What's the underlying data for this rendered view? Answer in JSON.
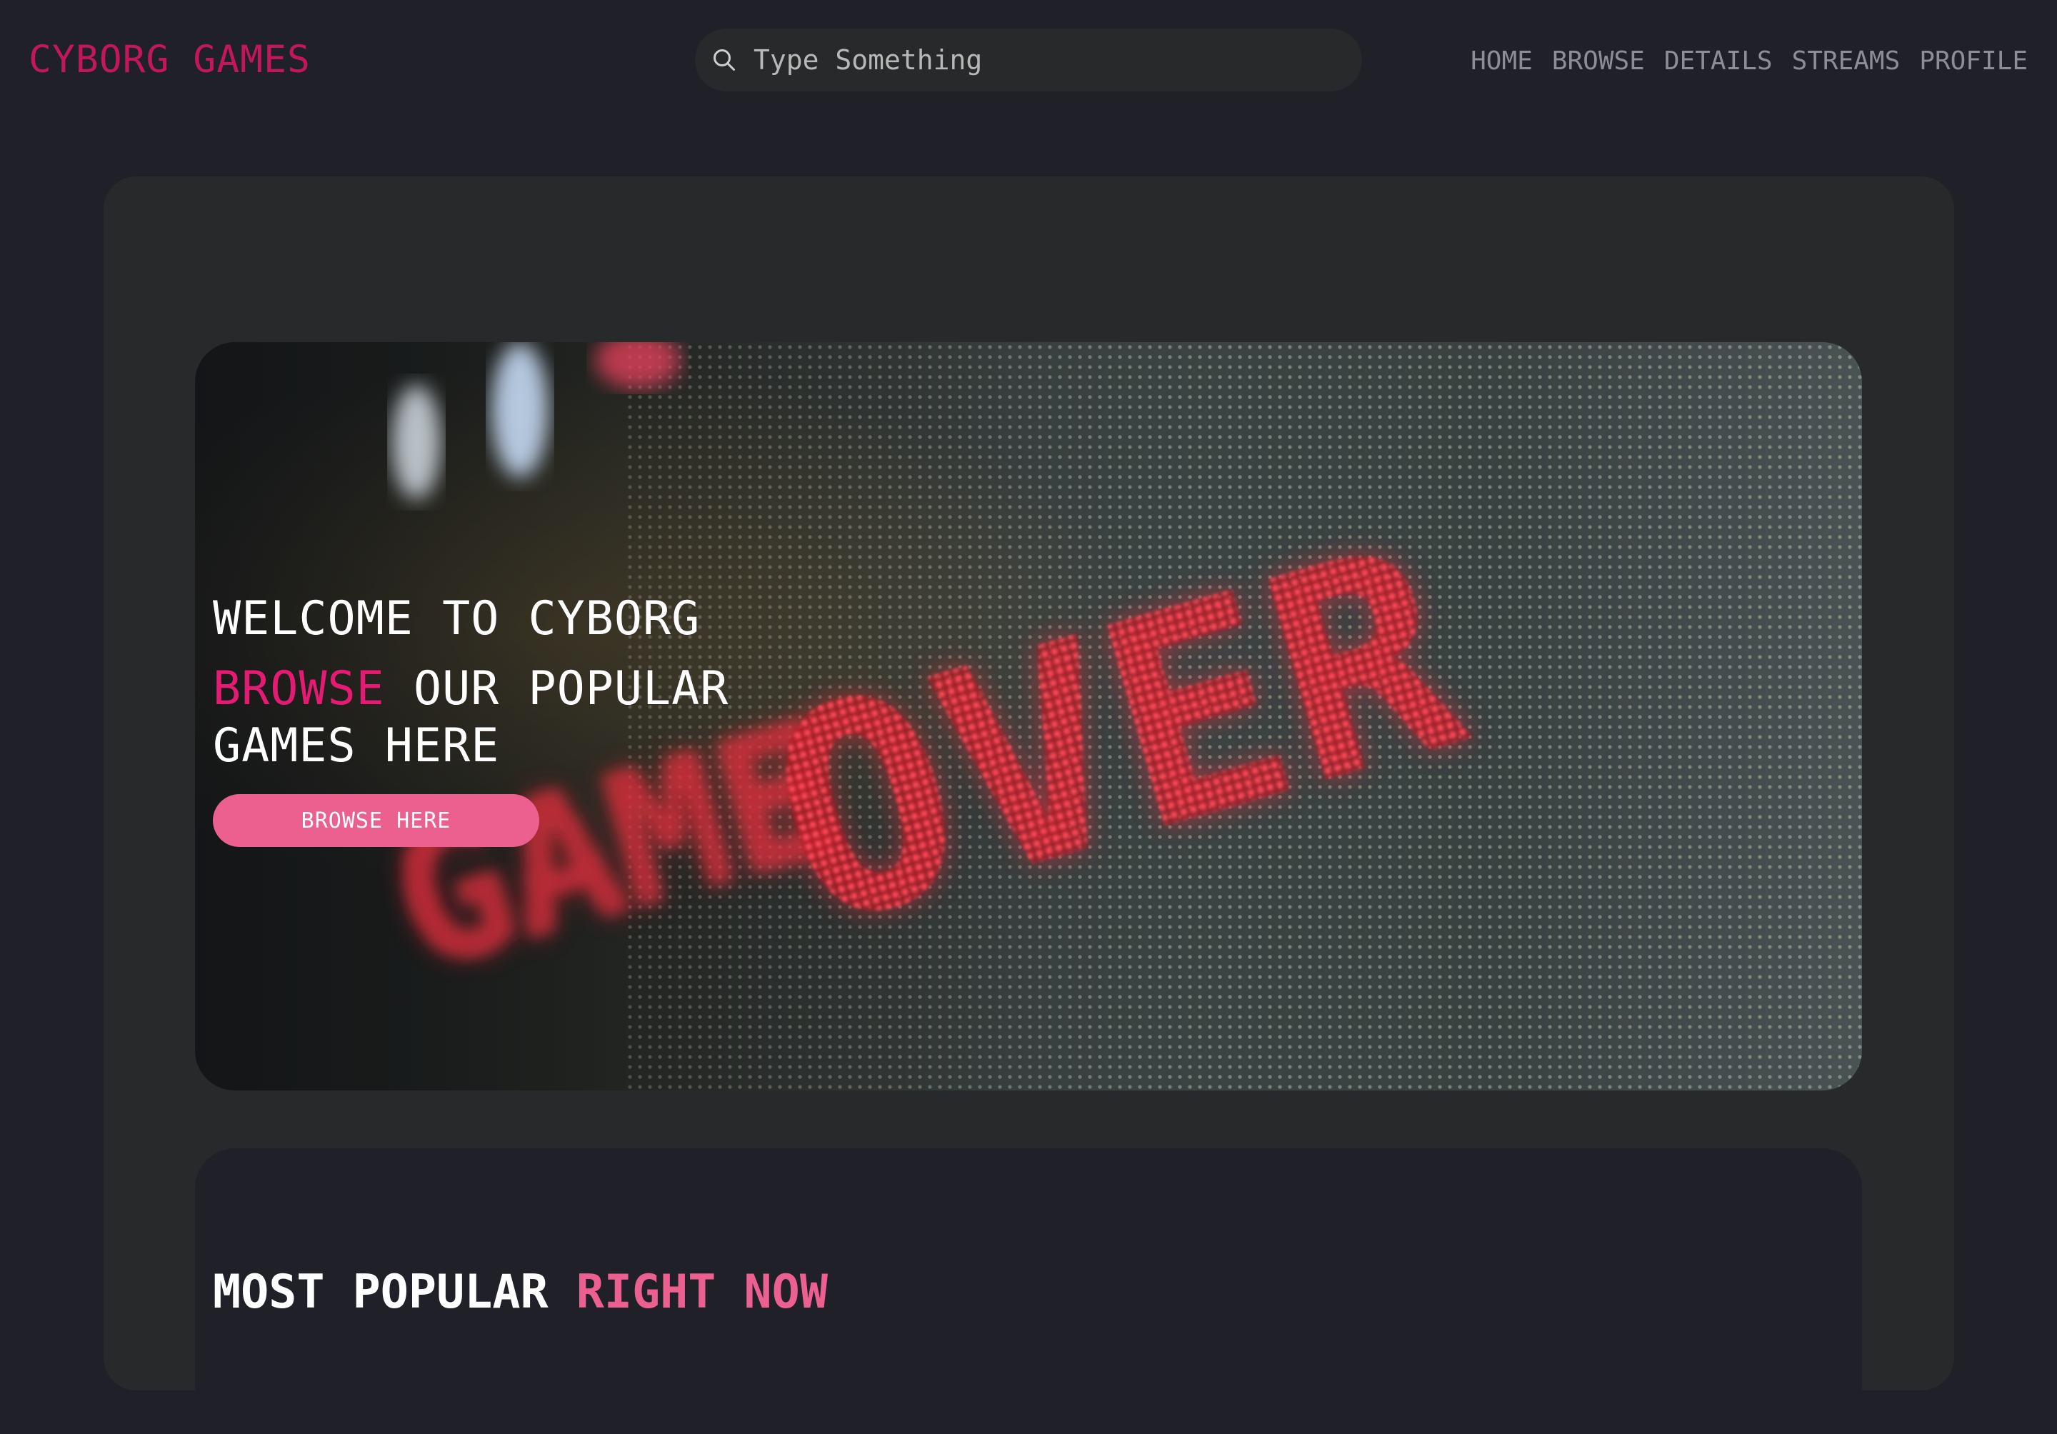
{
  "header": {
    "logo": "CYBORG GAMES",
    "search_placeholder": "Type Something",
    "nav": [
      "HOME",
      "BROWSE",
      "DETAILS",
      "STREAMS",
      "PROFILE"
    ]
  },
  "hero": {
    "welcome": "WELCOME TO CYBORG",
    "heading_accent": "BROWSE",
    "heading_rest": " OUR POPULAR GAMES HERE",
    "button_label": "BROWSE HERE",
    "image_text_1": "GAME",
    "image_text_2": "OVER"
  },
  "popular": {
    "title_main": "MOST POPULAR",
    "title_accent": "RIGHT NOW"
  },
  "colors": {
    "background": "#1f2028",
    "panel": "#27292a",
    "logo": "#c2185b",
    "accent": "#e51b73",
    "button": "#ec6090",
    "nav_text": "#8d8d96"
  }
}
